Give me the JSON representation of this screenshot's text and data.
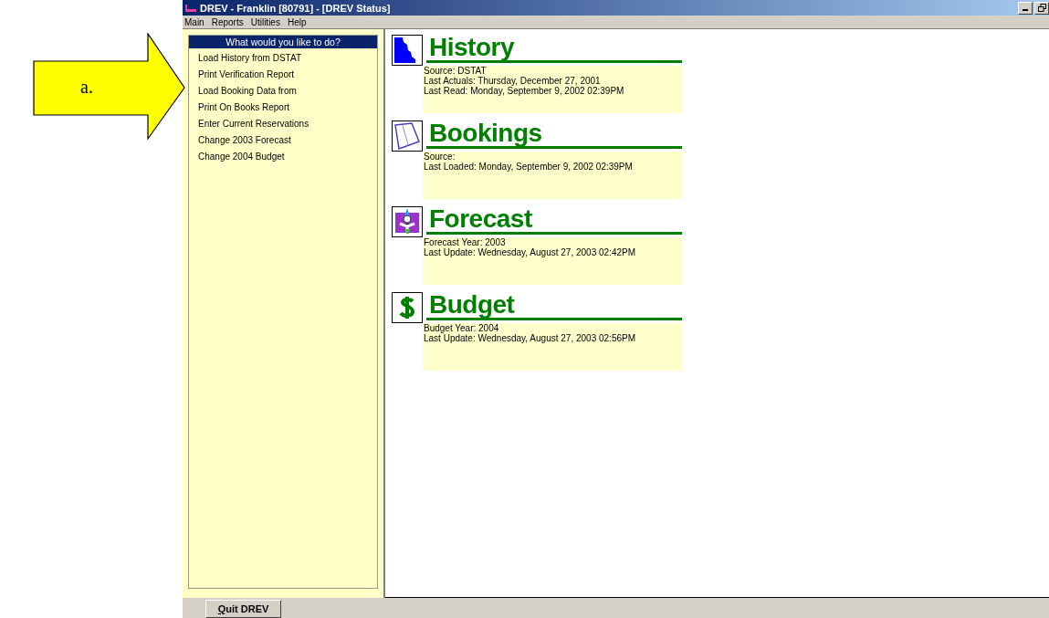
{
  "annotation": {
    "label": "a."
  },
  "window": {
    "title": "DREV - Franklin [80791] - [DREV Status]"
  },
  "menu": [
    "Main",
    "Reports",
    "Utilities",
    "Help"
  ],
  "sidebar": {
    "header": "What would you like to do?",
    "items": [
      "Load History from DSTAT",
      "Print Verification Report",
      "Load Booking Data from",
      "Print On Books Report",
      "Enter Current Reservations",
      "Change 2003 Forecast",
      "Change 2004 Budget"
    ]
  },
  "sections": [
    {
      "kind": "history",
      "title": "History",
      "lines": [
        "Source: DSTAT",
        "Last Actuals: Thursday, December 27, 2001",
        "Last Read: Monday, September 9, 2002 02:39PM"
      ]
    },
    {
      "kind": "bookings",
      "title": "Bookings",
      "lines": [
        "Source:",
        "Last Loaded: Monday, September 9, 2002 02:39PM"
      ]
    },
    {
      "kind": "forecast",
      "title": "Forecast",
      "lines": [
        "Forecast Year: 2003",
        "Last Update: Wednesday, August 27, 2003 02:42PM"
      ]
    },
    {
      "kind": "budget",
      "title": "Budget",
      "lines": [
        "Budget Year: 2004",
        "Last Update: Wednesday, August 27, 2003 02:56PM"
      ]
    }
  ],
  "buttons": [
    "Quit DREV"
  ]
}
